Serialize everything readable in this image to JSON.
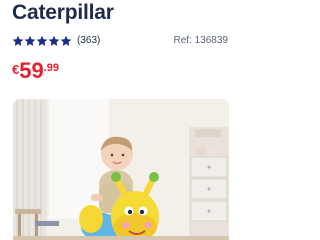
{
  "product": {
    "title": "Caterpillar",
    "rating": 5,
    "review_count": "(363)",
    "reference": "Ref: 136839",
    "price": {
      "currency": "€",
      "integer": "59",
      "decimal": ".99"
    },
    "image_icon": "product-photo-caterpillar-ride-on"
  },
  "colors": {
    "title": "#1f2c4d",
    "star": "#1c2f86",
    "price": "#e4202f"
  }
}
